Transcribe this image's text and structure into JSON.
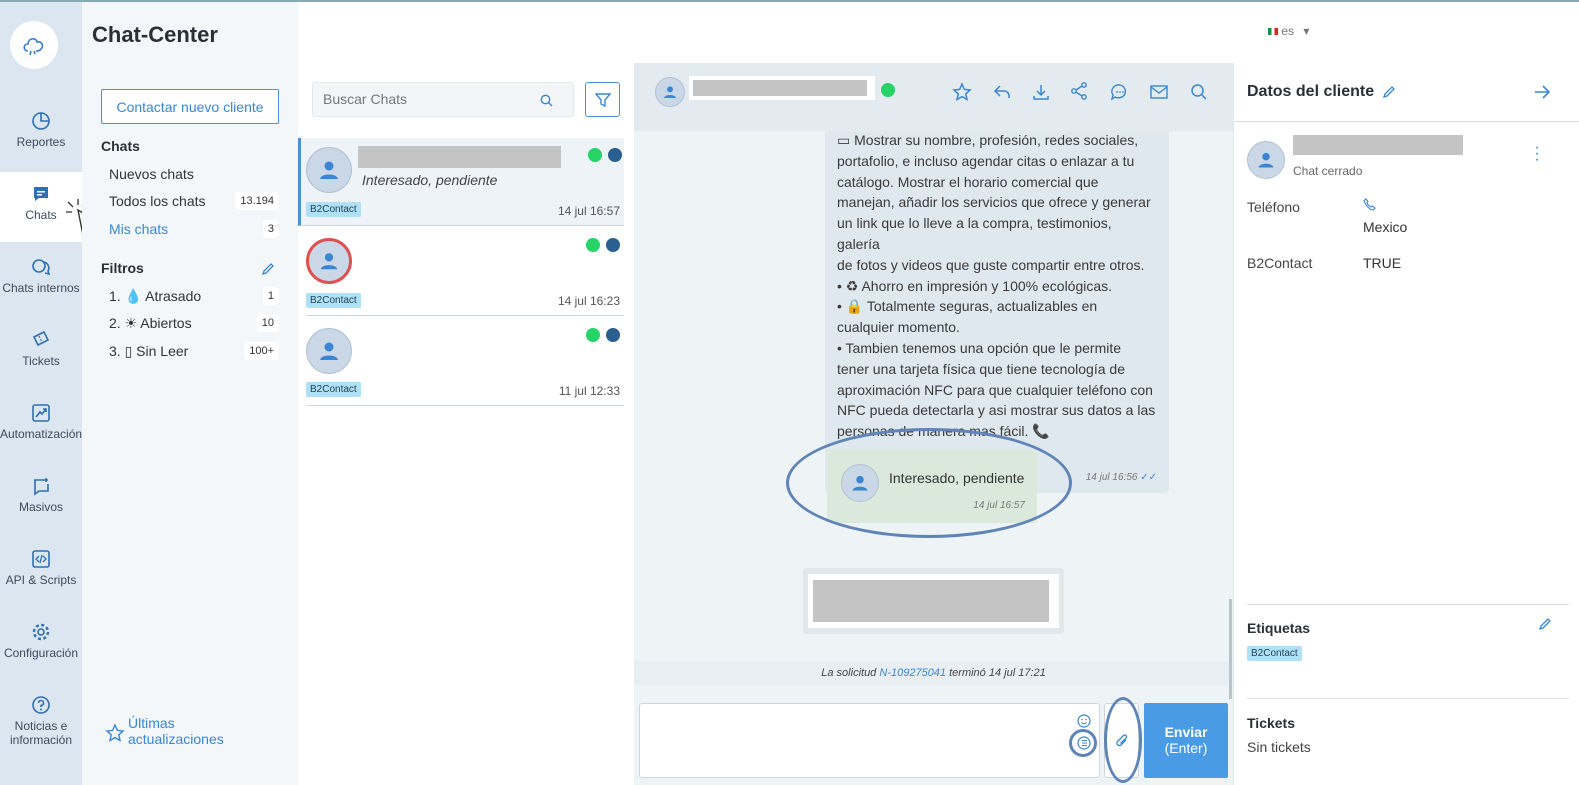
{
  "app": {
    "title": "Chat-Center"
  },
  "rail": [
    {
      "label": "Reportes",
      "icon": "pie-chart-icon"
    },
    {
      "label": "Chats",
      "icon": "chat-icon"
    },
    {
      "label": "Chats internos",
      "icon": "internal-chat-icon"
    },
    {
      "label": "Tickets",
      "icon": "ticket-icon"
    },
    {
      "label": "Automatización",
      "icon": "automation-icon"
    },
    {
      "label": "Masivos",
      "icon": "bulk-message-icon"
    },
    {
      "label": "API & Scripts",
      "icon": "code-icon"
    },
    {
      "label": "Configuración",
      "icon": "gear-icon"
    },
    {
      "label": "Noticias e información",
      "icon": "help-icon"
    }
  ],
  "nav": {
    "new_client": "Contactar nuevo cliente",
    "chats_header": "Chats",
    "new_chats": "Nuevos chats",
    "all_chats": "Todos los chats",
    "all_chats_count": "13.194",
    "my_chats": "Mis chats",
    "my_chats_count": "3",
    "filters_header": "Filtros",
    "filters": [
      {
        "label": "1. 💧 Atrasado",
        "count": "1"
      },
      {
        "label": "2. ☀ Abiertos",
        "count": "10"
      },
      {
        "label": "3. ▯ Sin Leer",
        "count": "100+"
      }
    ],
    "updates": "Últimas actualizaciones"
  },
  "topbar": {
    "lang": "es"
  },
  "search": {
    "placeholder": "Buscar Chats"
  },
  "chats": [
    {
      "preview": "Interesado, pendiente",
      "tag": "B2Contact",
      "time": "14 jul 16:57"
    },
    {
      "preview": "",
      "tag": "B2Contact",
      "time": "14 jul 16:23"
    },
    {
      "preview": "",
      "tag": "B2Contact",
      "time": "11 jul 12:33"
    }
  ],
  "conversation": {
    "message_lines": [
      "▭ Mostrar su nombre, profesión, redes sociales,",
      "portafolio, e incluso agendar citas o enlazar a tu",
      "catálogo. Mostrar el horario comercial que",
      "manejan, añadir los servicios que ofrece y generar",
      "un link que lo lleve a la compra, testimonios, galería",
      "de fotos y videos que guste compartir entre otros.",
      "•  ♻ Ahorro en impresión y 100% ecológicas.",
      "•  🔒 Totalmente seguras, actualizables en",
      "cualquier momento.",
      "•  Tambien tenemos una opción que le permite",
      "tener una tarjeta física que tiene tecnología de",
      "aproximación NFC para que cualquier teléfono con",
      "NFC pueda detectarla y asi mostrar sus datos a las",
      "personas de manera mas fácil.  📞"
    ],
    "message_time": "14 jul 16:56",
    "note_text": "Interesado, pendiente",
    "note_time": "14 jul 16:57",
    "system_prefix": "La solicitud",
    "system_ticket": "N-109275041",
    "system_suffix": "terminó 14 jul 17:21",
    "send_label": "Enviar",
    "send_hint": "(Enter)"
  },
  "client": {
    "title": "Datos del cliente",
    "status": "Chat cerrado",
    "phone_label": "Teléfono",
    "phone_country": "Mexico",
    "b2_label": "B2Contact",
    "b2_value": "TRUE",
    "tags_header": "Etiquetas",
    "tag": "B2Contact",
    "tickets_header": "Tickets",
    "tickets_value": "Sin tickets"
  },
  "colors": {
    "accent": "#4a90d9",
    "whatsapp": "#25d366",
    "rail": "#dce6f0"
  }
}
